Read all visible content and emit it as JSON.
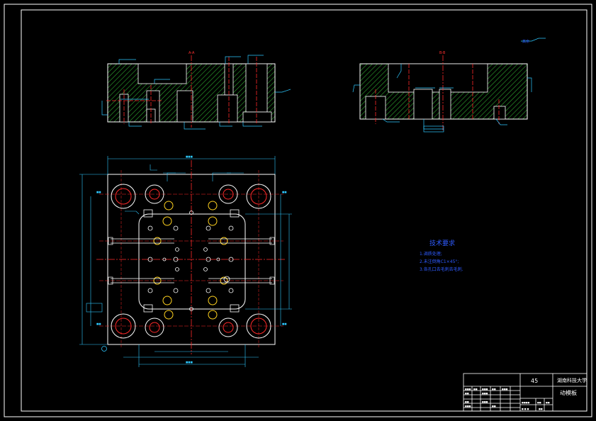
{
  "notes": {
    "title": "技术要求",
    "lines": [
      "1.调质处理;",
      "2.未注倒角C1×45°;",
      "3.各孔口去毛刺去毛刺."
    ]
  },
  "title_block": {
    "material": "45",
    "school": "湖南科技大学",
    "part_name": "动模板"
  },
  "section_labels": {
    "left_section": "A-A",
    "right_section": "B-B"
  },
  "roughness_note": "其余"
}
